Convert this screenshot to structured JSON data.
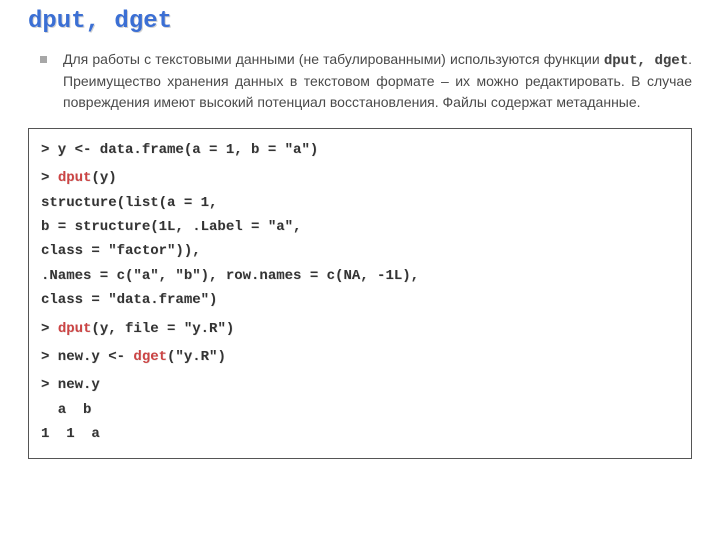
{
  "title": "dput, dget",
  "paragraph": {
    "pre": "Для работы с текстовыми данными (не табулированными) используются функции ",
    "mono": "dput, dget",
    "post": ". Преимущество хранения данных в текстовом формате – их можно редактировать. В случае повреждения имеют высокий потенциал восстановления.  Файлы содержат метаданные."
  },
  "code": {
    "l1a": "> y <- data.frame(a = 1, b = \"a\")",
    "l2_prompt": "> ",
    "l2_fn": "dput",
    "l2_rest": "(y)",
    "l3": "structure(list(a = 1,",
    "l4": "b = structure(1L, .Label = \"a\",",
    "l5": "class = \"factor\")),",
    "l6": ".Names = c(\"a\", \"b\"), row.names = c(NA, -1L),",
    "l7": "class = \"data.frame\")",
    "l8_prompt": "> ",
    "l8_fn": "dput",
    "l8_rest": "(y, file = \"y.R\")",
    "l9_a": "> new.y <- ",
    "l9_fn": "dget",
    "l9_rest": "(\"y.R\")",
    "l10": "> new.y",
    "l11": "  a  b",
    "l12": "1  1  a"
  }
}
